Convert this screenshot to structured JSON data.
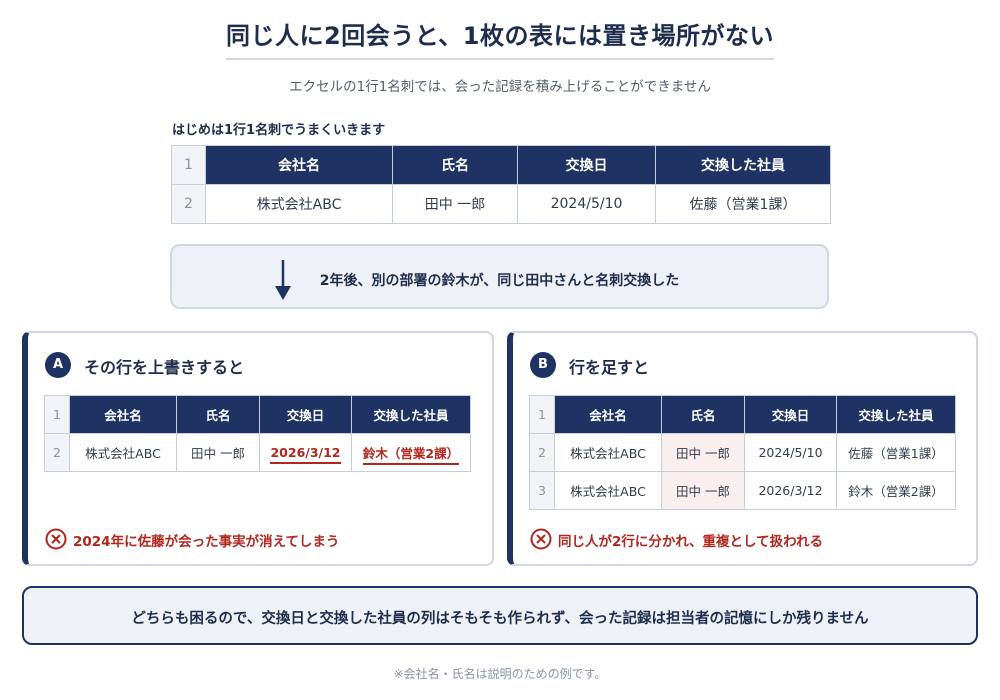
{
  "title": "同じ人に2回会うと、1枚の表には置き場所がない",
  "subtitle": "エクセルの1行1名刺では、会った記録を積み上げることができません",
  "section_label": "はじめは1行1名刺でうまくいきます",
  "columns": [
    "会社名",
    "氏名",
    "交換日",
    "交換した社員"
  ],
  "initial_table": {
    "row_numbers": [
      "1",
      "2"
    ],
    "rows": [
      [
        "株式会社ABC",
        "田中 一郎",
        "2024/5/10",
        "佐藤（営業1課）"
      ]
    ]
  },
  "transition": {
    "text": "2年後、別の部署の鈴木が、同じ田中さんと名刺交換した",
    "icon": "arrow-down-icon"
  },
  "option_a": {
    "badge": "A",
    "title": "その行を上書きすると",
    "row_numbers": [
      "1",
      "2"
    ],
    "rows": [
      [
        "株式会社ABC",
        "田中 一郎",
        "2026/3/12",
        "鈴木（営業2課）"
      ]
    ],
    "warning": "2024年に佐藤が会った事実が消えてしまう"
  },
  "option_b": {
    "badge": "B",
    "title": "行を足すと",
    "row_numbers": [
      "1",
      "2",
      "3"
    ],
    "rows": [
      [
        "株式会社ABC",
        "田中 一郎",
        "2024/5/10",
        "佐藤（営業1課）"
      ],
      [
        "株式会社ABC",
        "田中 一郎",
        "2026/3/12",
        "鈴木（営業2課）"
      ]
    ],
    "warning": "同じ人が2行に分かれ、重複として扱われる"
  },
  "conclusion": "どちらも困るので、交換日と交換した社員の列はそもそも作られず、会った記録は担当者の記憶にしか残りません",
  "footnote": "※会社名・氏名は説明のための例です。",
  "colors": {
    "navy": "#1e3264",
    "warning_red": "#b3261e",
    "light_panel": "#eef1f8",
    "highlight_pink": "#fbeeee"
  }
}
